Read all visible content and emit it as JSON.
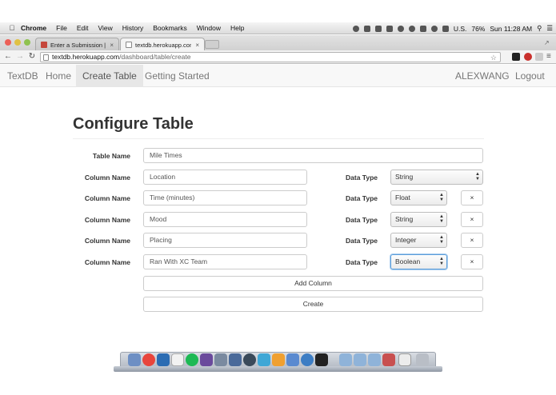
{
  "menubar": {
    "app_name": "Chrome",
    "menus": [
      "File",
      "Edit",
      "View",
      "History",
      "Bookmarks",
      "Window",
      "Help"
    ],
    "input_source": "U.S.",
    "battery": "76%",
    "clock": "Sun 11:28 AM"
  },
  "tabs": [
    {
      "title": "Enter a Submission | Wildc",
      "active": false
    },
    {
      "title": "textdb.herokuapp.com/da",
      "active": true
    }
  ],
  "address_bar": {
    "host": "textdb.herokuapp.com",
    "path": "/dashboard/table/create"
  },
  "navbar": {
    "brand": "TextDB",
    "home": "Home",
    "create_table": "Create Table",
    "getting_started": "Getting Started",
    "user": "ALEXWANG",
    "logout": "Logout"
  },
  "form": {
    "title": "Configure Table",
    "table_name_label": "Table Name",
    "table_name_value": "Mile Times",
    "column_label": "Column Name",
    "data_type_label": "Data Type",
    "remove_label": "×",
    "columns": [
      {
        "name": "Location",
        "type": "String"
      },
      {
        "name": "Time (minutes)",
        "type": "Float"
      },
      {
        "name": "Mood",
        "type": "String"
      },
      {
        "name": "Placing",
        "type": "Integer"
      },
      {
        "name": "Ran With XC Team",
        "type": "Boolean"
      }
    ],
    "add_column_label": "Add Column",
    "create_label": "Create"
  },
  "colors": {
    "navbar_bg": "#f8f8f8",
    "navbar_active": "#e7e7e7",
    "focus_ring": "#5b9dd9"
  }
}
